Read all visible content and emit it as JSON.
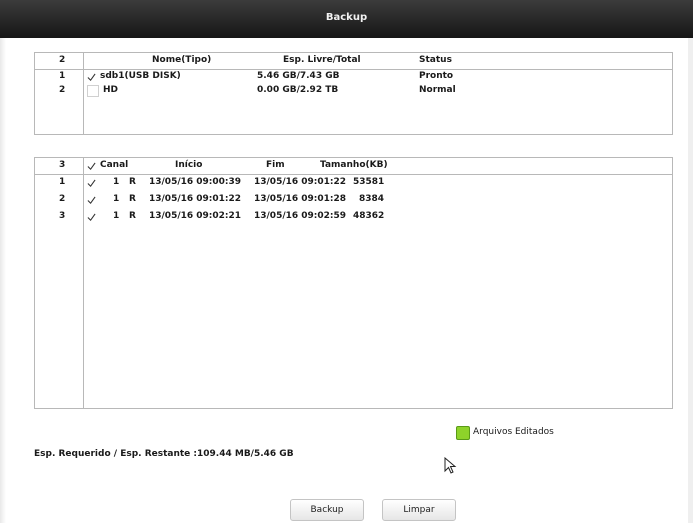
{
  "window": {
    "title": "Backup"
  },
  "devices": {
    "headers": [
      "2",
      "Nome(Tipo)",
      "Esp. Livre/Total",
      "Status"
    ],
    "rows": [
      {
        "idx": "1",
        "checked": true,
        "name": "sdb1(USB DISK)",
        "space": "5.46 GB/7.43 GB",
        "status": "Pronto"
      },
      {
        "idx": "2",
        "checked": false,
        "name": "HD",
        "space": "0.00 GB/2.92 TB",
        "status": "Normal"
      }
    ]
  },
  "files": {
    "headers": [
      "3",
      "Canal",
      "Início",
      "Fim",
      "Tamanho(KB)"
    ],
    "rows": [
      {
        "idx": "1",
        "channel": "1",
        "type": "R",
        "start": "13/05/16 09:00:39",
        "end": "13/05/16 09:01:22",
        "size": "53581"
      },
      {
        "idx": "2",
        "channel": "1",
        "type": "R",
        "start": "13/05/16 09:01:22",
        "end": "13/05/16 09:01:28",
        "size": "8384"
      },
      {
        "idx": "3",
        "channel": "1",
        "type": "R",
        "start": "13/05/16 09:02:21",
        "end": "13/05/16 09:02:59",
        "size": "48362"
      }
    ]
  },
  "legend": {
    "label": "Arquivos Editados",
    "color": "#8ed32a"
  },
  "space_info": "Esp. Requerido / Esp. Restante :109.44 MB/5.46 GB",
  "buttons": {
    "backup": "Backup",
    "clear": "Limpar"
  }
}
